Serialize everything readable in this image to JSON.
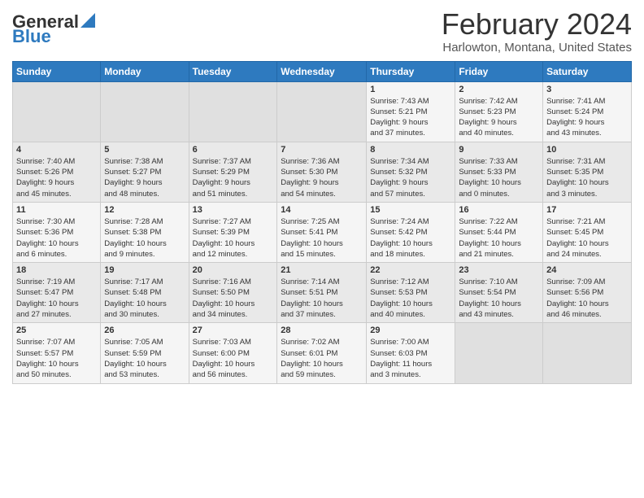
{
  "header": {
    "logo_general": "General",
    "logo_blue": "Blue",
    "title": "February 2024",
    "subtitle": "Harlowton, Montana, United States"
  },
  "calendar": {
    "days_of_week": [
      "Sunday",
      "Monday",
      "Tuesday",
      "Wednesday",
      "Thursday",
      "Friday",
      "Saturday"
    ],
    "weeks": [
      [
        {
          "day": "",
          "info": ""
        },
        {
          "day": "",
          "info": ""
        },
        {
          "day": "",
          "info": ""
        },
        {
          "day": "",
          "info": ""
        },
        {
          "day": "1",
          "info": "Sunrise: 7:43 AM\nSunset: 5:21 PM\nDaylight: 9 hours\nand 37 minutes."
        },
        {
          "day": "2",
          "info": "Sunrise: 7:42 AM\nSunset: 5:23 PM\nDaylight: 9 hours\nand 40 minutes."
        },
        {
          "day": "3",
          "info": "Sunrise: 7:41 AM\nSunset: 5:24 PM\nDaylight: 9 hours\nand 43 minutes."
        }
      ],
      [
        {
          "day": "4",
          "info": "Sunrise: 7:40 AM\nSunset: 5:26 PM\nDaylight: 9 hours\nand 45 minutes."
        },
        {
          "day": "5",
          "info": "Sunrise: 7:38 AM\nSunset: 5:27 PM\nDaylight: 9 hours\nand 48 minutes."
        },
        {
          "day": "6",
          "info": "Sunrise: 7:37 AM\nSunset: 5:29 PM\nDaylight: 9 hours\nand 51 minutes."
        },
        {
          "day": "7",
          "info": "Sunrise: 7:36 AM\nSunset: 5:30 PM\nDaylight: 9 hours\nand 54 minutes."
        },
        {
          "day": "8",
          "info": "Sunrise: 7:34 AM\nSunset: 5:32 PM\nDaylight: 9 hours\nand 57 minutes."
        },
        {
          "day": "9",
          "info": "Sunrise: 7:33 AM\nSunset: 5:33 PM\nDaylight: 10 hours\nand 0 minutes."
        },
        {
          "day": "10",
          "info": "Sunrise: 7:31 AM\nSunset: 5:35 PM\nDaylight: 10 hours\nand 3 minutes."
        }
      ],
      [
        {
          "day": "11",
          "info": "Sunrise: 7:30 AM\nSunset: 5:36 PM\nDaylight: 10 hours\nand 6 minutes."
        },
        {
          "day": "12",
          "info": "Sunrise: 7:28 AM\nSunset: 5:38 PM\nDaylight: 10 hours\nand 9 minutes."
        },
        {
          "day": "13",
          "info": "Sunrise: 7:27 AM\nSunset: 5:39 PM\nDaylight: 10 hours\nand 12 minutes."
        },
        {
          "day": "14",
          "info": "Sunrise: 7:25 AM\nSunset: 5:41 PM\nDaylight: 10 hours\nand 15 minutes."
        },
        {
          "day": "15",
          "info": "Sunrise: 7:24 AM\nSunset: 5:42 PM\nDaylight: 10 hours\nand 18 minutes."
        },
        {
          "day": "16",
          "info": "Sunrise: 7:22 AM\nSunset: 5:44 PM\nDaylight: 10 hours\nand 21 minutes."
        },
        {
          "day": "17",
          "info": "Sunrise: 7:21 AM\nSunset: 5:45 PM\nDaylight: 10 hours\nand 24 minutes."
        }
      ],
      [
        {
          "day": "18",
          "info": "Sunrise: 7:19 AM\nSunset: 5:47 PM\nDaylight: 10 hours\nand 27 minutes."
        },
        {
          "day": "19",
          "info": "Sunrise: 7:17 AM\nSunset: 5:48 PM\nDaylight: 10 hours\nand 30 minutes."
        },
        {
          "day": "20",
          "info": "Sunrise: 7:16 AM\nSunset: 5:50 PM\nDaylight: 10 hours\nand 34 minutes."
        },
        {
          "day": "21",
          "info": "Sunrise: 7:14 AM\nSunset: 5:51 PM\nDaylight: 10 hours\nand 37 minutes."
        },
        {
          "day": "22",
          "info": "Sunrise: 7:12 AM\nSunset: 5:53 PM\nDaylight: 10 hours\nand 40 minutes."
        },
        {
          "day": "23",
          "info": "Sunrise: 7:10 AM\nSunset: 5:54 PM\nDaylight: 10 hours\nand 43 minutes."
        },
        {
          "day": "24",
          "info": "Sunrise: 7:09 AM\nSunset: 5:56 PM\nDaylight: 10 hours\nand 46 minutes."
        }
      ],
      [
        {
          "day": "25",
          "info": "Sunrise: 7:07 AM\nSunset: 5:57 PM\nDaylight: 10 hours\nand 50 minutes."
        },
        {
          "day": "26",
          "info": "Sunrise: 7:05 AM\nSunset: 5:59 PM\nDaylight: 10 hours\nand 53 minutes."
        },
        {
          "day": "27",
          "info": "Sunrise: 7:03 AM\nSunset: 6:00 PM\nDaylight: 10 hours\nand 56 minutes."
        },
        {
          "day": "28",
          "info": "Sunrise: 7:02 AM\nSunset: 6:01 PM\nDaylight: 10 hours\nand 59 minutes."
        },
        {
          "day": "29",
          "info": "Sunrise: 7:00 AM\nSunset: 6:03 PM\nDaylight: 11 hours\nand 3 minutes."
        },
        {
          "day": "",
          "info": ""
        },
        {
          "day": "",
          "info": ""
        }
      ]
    ]
  }
}
